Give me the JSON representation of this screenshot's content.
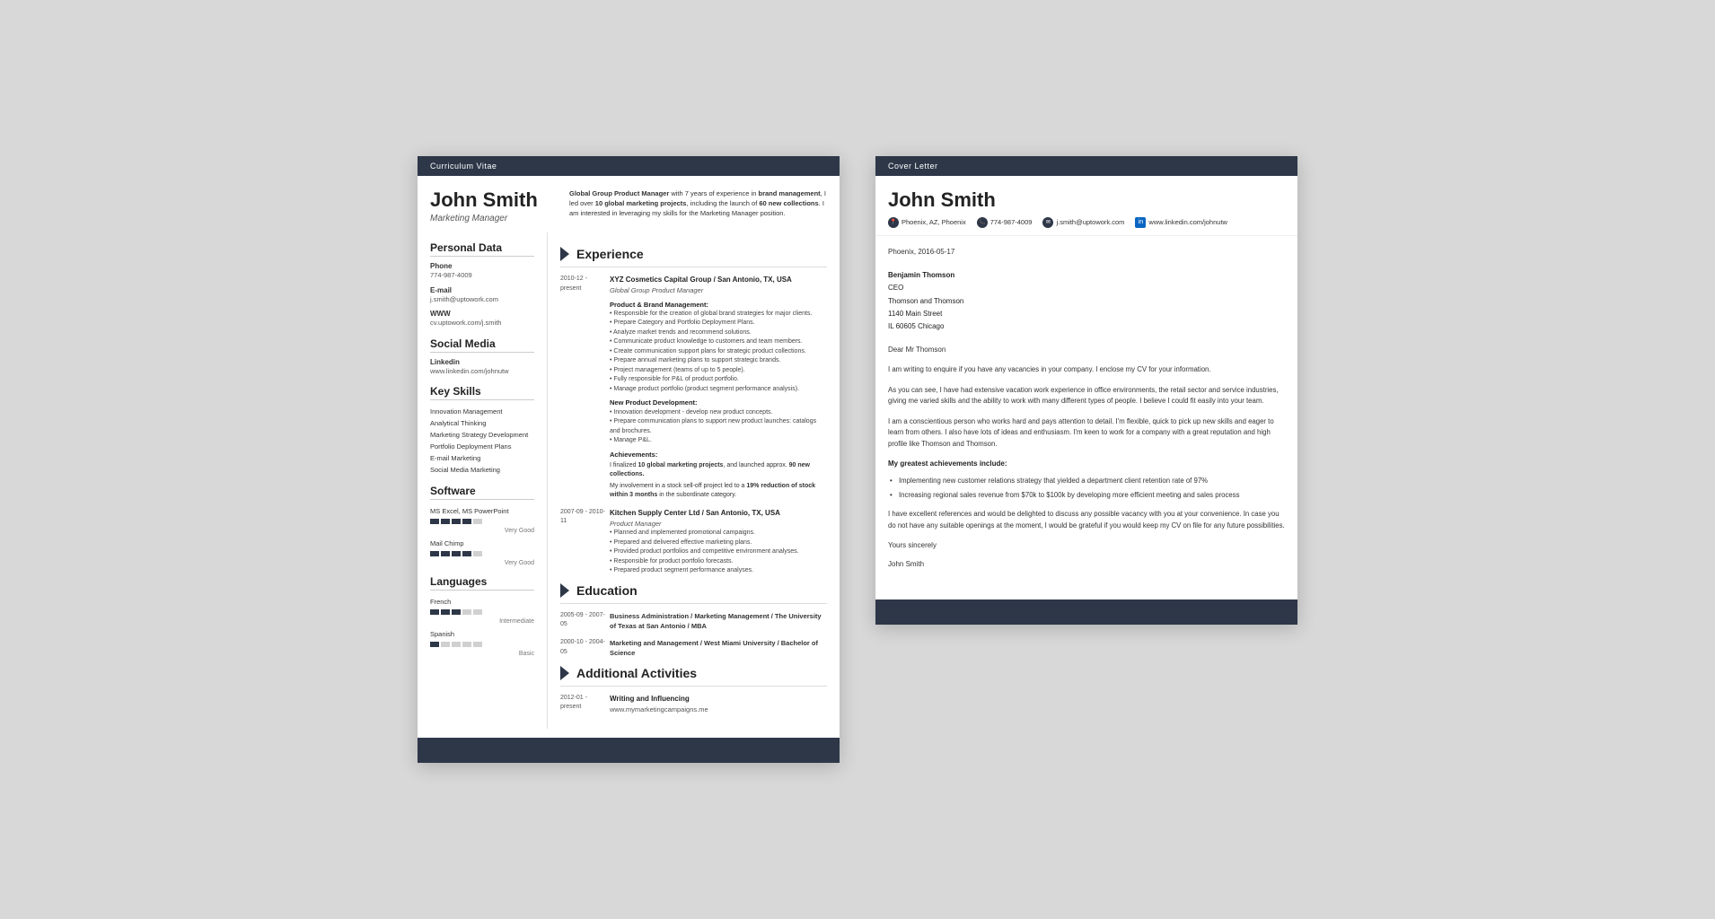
{
  "cv": {
    "header_bar": "Curriculum Vitae",
    "name": "John Smith",
    "job_title": "Marketing Manager",
    "intro": {
      "text": " with 7 years of experience in ",
      "highlight1": "Global Group Product Manager",
      "highlight2": "brand management",
      "text2": ", I led over ",
      "highlight3": "10 global marketing projects",
      "text3": ", including the launch of ",
      "highlight4": "60 new collections",
      "text4": ". I am interested in leveraging my skills for the Marketing Manager position."
    },
    "sidebar": {
      "personal_data_title": "Personal Data",
      "phone_label": "Phone",
      "phone_value": "774-987-4009",
      "email_label": "E-mail",
      "email_value": "j.smith@uptowork.com",
      "www_label": "WWW",
      "www_value": "cv.uptowork.com/j.smith",
      "social_media_title": "Social Media",
      "linkedin_label": "Linkedin",
      "linkedin_value": "www.linkedin.com/johnutw",
      "key_skills_title": "Key Skills",
      "skills": [
        "Innovation Management",
        "Analytical Thinking",
        "Marketing Strategy Development",
        "Portfolio Deployment Plans",
        "E-mail Marketing",
        "Social Media Marketing"
      ],
      "software_title": "Software",
      "software_items": [
        {
          "name": "MS Excel, MS PowerPoint",
          "level": 4,
          "max": 5,
          "label": "Very Good"
        },
        {
          "name": "Mail Chimp",
          "level": 4,
          "max": 5,
          "label": "Very Good"
        }
      ],
      "languages_title": "Languages",
      "languages": [
        {
          "name": "French",
          "level": 3,
          "max": 5,
          "label": "Intermediate"
        },
        {
          "name": "Spanish",
          "level": 1,
          "max": 5,
          "label": "Basic"
        }
      ]
    },
    "experience_title": "Experience",
    "experience": [
      {
        "date": "2010-12 - present",
        "company": "XYZ Cosmetics Capital Group / San Antonio, TX, USA",
        "role": "Global Group Product Manager",
        "subsection1": "Product & Brand Management:",
        "bullets1": [
          "Responsible for the creation of global brand strategies for major clients.",
          "Prepare Category and Portfolio Deployment Plans.",
          "Analyze market trends and recommend solutions.",
          "Communicate product knowledge to customers and team members.",
          "Create communication support plans for strategic product collections.",
          "Prepare annual marketing plans to support strategic brands.",
          "Project management (teams of up to 5 people).",
          "Fully responsible for P&L of product portfolio.",
          "Manage product portfolio (product segment performance analysis)."
        ],
        "subsection2": "New Product Development:",
        "bullets2": [
          "Innovation development - develop new product concepts.",
          "Prepare communication plans to support new product launches: catalogs and brochures.",
          "Manage P&L."
        ],
        "subsection3": "Achievements:",
        "achievements": [
          "I finalized 10 global marketing projects, and launched approx. 90 new collections.",
          "My involvement in a stock sell-off project led to a 19% reduction of stock within 3 months in the subordinate category."
        ]
      },
      {
        "date": "2007-09 - 2010-11",
        "company": "Kitchen Supply Center Ltd / San Antonio, TX, USA",
        "role": "Product Manager",
        "bullets1": [
          "Planned and implemented promotional campaigns.",
          "Prepared and delivered effective marketing plans.",
          "Provided product portfolios and competitive environment analyses.",
          "Responsible for product portfolio forecasts.",
          "Prepared product segment performance analyses."
        ]
      }
    ],
    "education_title": "Education",
    "education": [
      {
        "date": "2005-09 - 2007-05",
        "degree": "Business Administration / Marketing Management / The University of Texas at San Antonio / MBA"
      },
      {
        "date": "2000-10 - 2004-05",
        "degree": "Marketing and Management / West Miami University / Bachelor of Science"
      }
    ],
    "activities_title": "Additional Activities",
    "activities": [
      {
        "date": "2012-01 - present",
        "title": "Writing and Influencing",
        "detail": "www.mymarketingcampaigns.me"
      }
    ]
  },
  "cover_letter": {
    "header_bar": "Cover Letter",
    "name": "John Smith",
    "contact": {
      "location": "Phoenix, AZ, Phoenix",
      "phone": "774-987-4009",
      "email": "j.smith@uptowork.com",
      "linkedin": "www.linkedin.com/johnutw"
    },
    "date": "Phoenix, 2016-05-17",
    "recipient": {
      "name": "Benjamin Thomson",
      "title": "CEO",
      "company": "Thomson and Thomson",
      "address": "1140 Main Street",
      "city": "IL 60605 Chicago"
    },
    "salutation": "Dear Mr Thomson",
    "paragraph1": "I am writing to enquire if you have any vacancies in your company. I enclose my CV for your information.",
    "paragraph2": "As you can see, I have had extensive vacation work experience in office environments, the retail sector and service industries, giving me varied skills and the ability to work with many different types of people. I believe I could fit easily into your team.",
    "paragraph3": "I am a conscientious person who works hard and pays attention to detail. I'm flexible, quick to pick up new skills and eager to learn from others. I also have lots of ideas and enthusiasm. I'm keen to work for a company with a great reputation and high profile like Thomson and Thomson.",
    "achievements_title": "My greatest achievements include:",
    "achievements": [
      "Implementing new customer relations strategy that yielded a department client retention rate of 97%",
      "Increasing regional sales revenue from $70k to $100k by developing more efficient meeting and sales process"
    ],
    "paragraph4": "I have excellent references and would be delighted to discuss any possible vacancy with you at your convenience. In case you do not have any suitable openings at the moment, I would be grateful if you would keep my CV on file for any future possibilities.",
    "closing": "Yours sincerely",
    "signature": "John Smith"
  }
}
